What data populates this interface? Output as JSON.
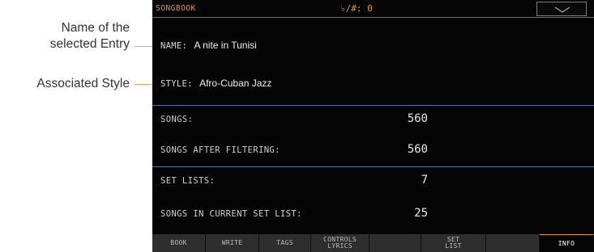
{
  "callouts": {
    "entry_line1": "Name of the",
    "entry_line2": "selected Entry",
    "style": "Associated Style"
  },
  "header": {
    "title": "SONGBOOK",
    "transpose": "♭/#: 0",
    "menu_icon": "chevron-down-icon"
  },
  "entry": {
    "name_label": "NAME:",
    "name_value": "A nite in Tunisi",
    "style_label": "STYLE:",
    "style_value": "Afro-Cuban Jazz"
  },
  "stats": [
    {
      "label": "SONGS:",
      "value": "560"
    },
    {
      "label": "SONGS AFTER FILTERING:",
      "value": "560"
    },
    {
      "label": "SET LISTS:",
      "value": "7"
    },
    {
      "label": "SONGS IN CURRENT SET LIST:",
      "value": "25"
    }
  ],
  "tabs": [
    {
      "line1": "BOOK",
      "line2": ""
    },
    {
      "line1": "WRITE",
      "line2": ""
    },
    {
      "line1": "TAGS",
      "line2": ""
    },
    {
      "line1": "CONTROLS",
      "line2": "LYRICS"
    },
    {
      "line1": "",
      "line2": ""
    },
    {
      "line1": "SET",
      "line2": "LIST"
    },
    {
      "line1": "",
      "line2": ""
    },
    {
      "line1": "INFO",
      "line2": ""
    }
  ],
  "colors": {
    "accent": "#e09a3a",
    "divider": "#5a6fa8",
    "callout_line": "#f0a060"
  }
}
